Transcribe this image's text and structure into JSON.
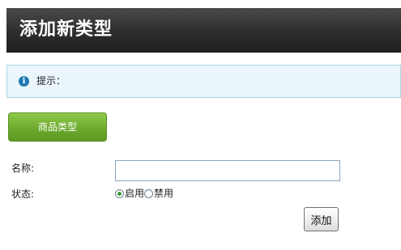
{
  "header": {
    "title": "添加新类型"
  },
  "tip": {
    "icon": "info-icon",
    "label": "提示："
  },
  "tab": {
    "label": "商品类型"
  },
  "form": {
    "name_label": "名称:",
    "name_value": "",
    "status_label": "状态:",
    "status_options": [
      {
        "label": "启用",
        "checked": true
      },
      {
        "label": "禁用",
        "checked": false
      }
    ],
    "submit_label": "添加"
  },
  "colors": {
    "header_bg": "#2d2d2d",
    "tip_bg": "#eaf6fb",
    "tip_border": "#a9d4e6",
    "tab_green": "#6aa72c",
    "info_blue": "#1f78b4"
  }
}
